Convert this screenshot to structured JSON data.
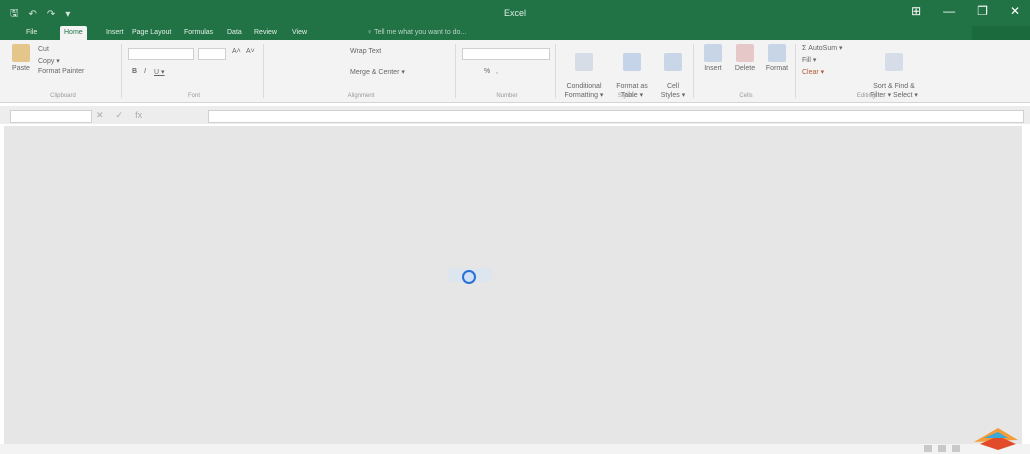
{
  "app": {
    "title": "Excel"
  },
  "qat": {
    "save": "🖫",
    "undo": "↶",
    "redo": "↷",
    "customize": "▾"
  },
  "window": {
    "ribbon_opts": "⊞",
    "minimize": "—",
    "restore": "❐",
    "close": "✕"
  },
  "tabs": [
    {
      "label": "File"
    },
    {
      "label": "Home"
    },
    {
      "label": "Insert"
    },
    {
      "label": "Page Layout"
    },
    {
      "label": "Formulas"
    },
    {
      "label": "Data"
    },
    {
      "label": "Review"
    },
    {
      "label": "View"
    }
  ],
  "tell_me": "♀ Tell me what you want to do...",
  "clipboard": {
    "paste": "Paste",
    "cut": "Cut",
    "copy": "Copy ▾",
    "painter": "Format Painter",
    "label": "Clipboard"
  },
  "font": {
    "grow": "A˄",
    "shrink": "A˅",
    "bold": "B",
    "italic": "I",
    "underline": "U ▾",
    "label": "Font"
  },
  "alignment": {
    "wrap": "Wrap Text",
    "merge": "Merge & Center ▾",
    "label": "Alignment"
  },
  "number": {
    "percent": "%",
    "comma": ",",
    "label": "Number"
  },
  "styles": {
    "conditional": "Conditional\nFormatting ▾",
    "format_table": "Format as\nTable ▾",
    "cell_styles": "Cell\nStyles ▾",
    "label": "Styles"
  },
  "cells": {
    "insert": "Insert",
    "delete": "Delete",
    "format": "Format",
    "label": "Cells"
  },
  "editing": {
    "autosum": "Σ AutoSum ▾",
    "fill": "Fill ▾",
    "clear": "Clear ▾",
    "sort": "Sort & Find &\nFilter ▾ Select ▾",
    "label": "Editing"
  },
  "formula": {
    "fx": "fx",
    "cancel": "✕",
    "enter": "✓"
  },
  "colors": {
    "excel_green": "#217346",
    "ribbon_bg": "#f3f3f3",
    "grid_bg": "#e6e6e6"
  }
}
